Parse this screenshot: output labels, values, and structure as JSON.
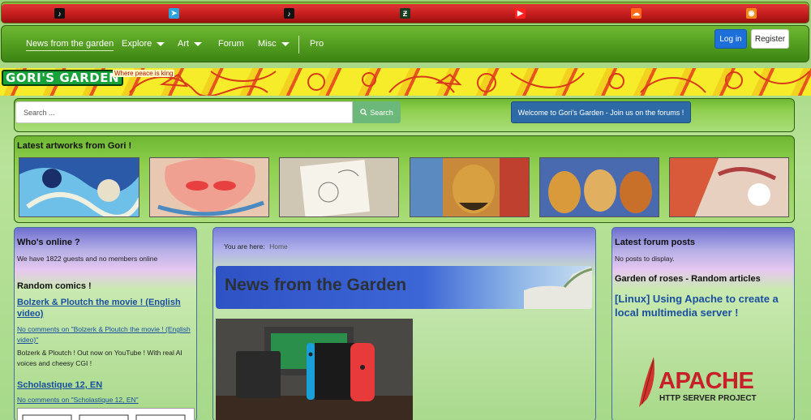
{
  "socialbar": {
    "icons": [
      {
        "name": "tiktok-icon",
        "glyph": "♪",
        "color": "#111111"
      },
      {
        "name": "telegram-icon",
        "glyph": "➤",
        "color": "#2aa3dd"
      },
      {
        "name": "tiktok-icon-2",
        "glyph": "♪",
        "color": "#111111"
      },
      {
        "name": "deviantart-icon",
        "glyph": "Ƶ",
        "color": "#1a3a22"
      },
      {
        "name": "youtube-icon",
        "glyph": "▶",
        "color": "#ff2020"
      },
      {
        "name": "soundcloud-icon",
        "glyph": "☁",
        "color": "#ff6a1a"
      },
      {
        "name": "rss-icon",
        "glyph": "◉",
        "color": "#f08a1a"
      }
    ]
  },
  "nav": {
    "items": [
      {
        "label": "News from the garden",
        "dropdown": false,
        "active": true
      },
      {
        "label": "Explore",
        "dropdown": true
      },
      {
        "label": "Art",
        "dropdown": true
      },
      {
        "label": "Forum",
        "dropdown": false
      },
      {
        "label": "Misc",
        "dropdown": true
      },
      {
        "label": "Pro",
        "dropdown": false
      }
    ],
    "login_label": "Log in",
    "register_label": "Register"
  },
  "banner": {
    "logo": "GORI'S GARDEN",
    "tagline": "Where peace is king"
  },
  "search": {
    "placeholder": "Search ...",
    "button_label": "Search",
    "welcome_label": "Welcome to Gori's Garden - Join us on the forums !"
  },
  "artworks": {
    "title": "Latest artworks from Gori !",
    "items": [
      {
        "name": "artwork-1",
        "palette": [
          "#1f4f9a",
          "#5fb8e0",
          "#e8e0c0",
          "#2a2a5a"
        ]
      },
      {
        "name": "artwork-2",
        "palette": [
          "#d98a7a",
          "#5fa0c8",
          "#e86a6a",
          "#f0d0a0"
        ]
      },
      {
        "name": "artwork-3",
        "palette": [
          "#e9e4d8",
          "#b8b0a0",
          "#8a7a70",
          "#d8d0c0"
        ]
      },
      {
        "name": "artwork-4",
        "palette": [
          "#d8a040",
          "#5a8ac0",
          "#c04030",
          "#3a3020"
        ]
      },
      {
        "name": "artwork-5",
        "palette": [
          "#d89a3a",
          "#4a6ab0",
          "#c05a2a",
          "#e0c070"
        ]
      },
      {
        "name": "artwork-6",
        "palette": [
          "#d85a3a",
          "#e8d0c0",
          "#b04040",
          "#f0e0d0"
        ]
      }
    ]
  },
  "left": {
    "online_title": "Who's online ?",
    "online_text": "We have 1822 guests and no members online",
    "comics_title": "Random comics !",
    "comic1_title": "Bolzerk & Ploutch the movie ! (English video)",
    "comic1_comments": "No comments on \"Bolzerk & Ploutch the movie ! (English video)\"",
    "comic1_text": "Bolzerk & Ploutch ! Out now on YouTube ! With real AI voices and cheesy CGI !",
    "comic2_title": "Scholastique 12, EN",
    "comic2_comments": "No comments on \"Scholastique 12, EN\""
  },
  "center": {
    "breadcrumb_prefix": "You are here:",
    "breadcrumb_home": "Home",
    "hero_title": "News from the Garden"
  },
  "right": {
    "forum_title": "Latest forum posts",
    "forum_text": "No posts to display.",
    "random_title": "Garden of roses - Random articles",
    "article_title": "[Linux] Using Apache to create a local multimedia server !",
    "apache_line1": "APACHE",
    "apache_line2": "HTTP SERVER PROJECT"
  }
}
